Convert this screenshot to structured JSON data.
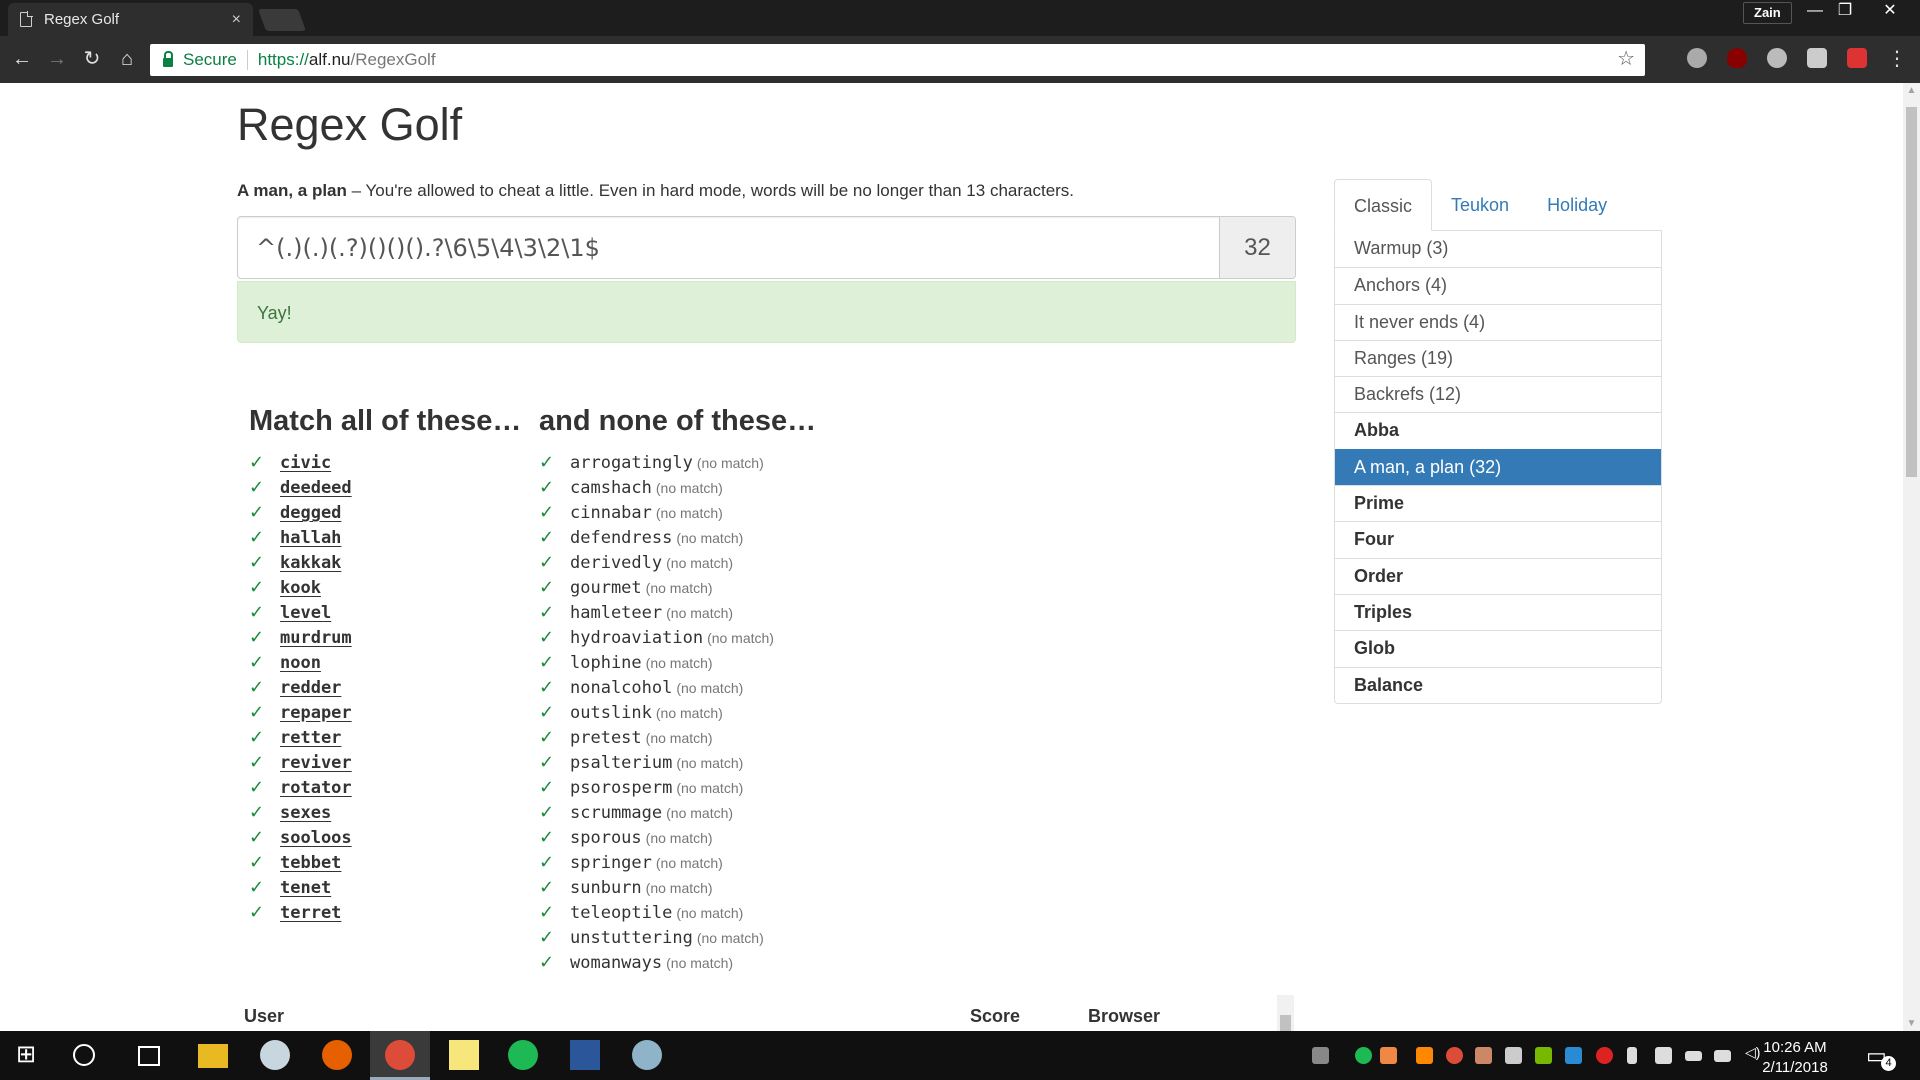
{
  "browser": {
    "tab_title": "Regex Golf",
    "tab_close": "×",
    "profile_name": "Zain",
    "url_secure_label": "Secure",
    "url_scheme": "https://",
    "url_host": "alf.nu",
    "url_path": "/RegexGolf"
  },
  "page": {
    "title": "Regex Golf",
    "level_name": "A man, a plan",
    "level_description": " – You're allowed to cheat a little. Even in hard mode, words will be no longer than 13 characters.",
    "regex_value": "^(.)(.)(.?)()()().?\\6\\5\\4\\3\\2\\1$",
    "score": "32",
    "result_message": "Yay!",
    "match_heading": "Match all of these…",
    "nomatch_heading": "and none of these…",
    "check_mark": "✓",
    "nomatch_note": "(no match)",
    "match_words": [
      "civic",
      "deedeed",
      "degged",
      "hallah",
      "kakkak",
      "kook",
      "level",
      "murdrum",
      "noon",
      "redder",
      "repaper",
      "retter",
      "reviver",
      "rotator",
      "sexes",
      "sooloos",
      "tebbet",
      "tenet",
      "terret"
    ],
    "nomatch_words": [
      "arrogatingly",
      "camshach",
      "cinnabar",
      "defendress",
      "derivedly",
      "gourmet",
      "hamleteer",
      "hydroaviation",
      "lophine",
      "nonalcohol",
      "outslink",
      "pretest",
      "psalterium",
      "psorosperm",
      "scrummage",
      "sporous",
      "springer",
      "sunburn",
      "teleoptile",
      "unstuttering",
      "womanways"
    ],
    "leaderboard_headers": {
      "user": "User",
      "score": "Score",
      "browser": "Browser"
    }
  },
  "sidebar": {
    "tabs": [
      "Classic",
      "Teukon",
      "Holiday"
    ],
    "active_tab": 0,
    "levels": [
      {
        "label": "Warmup (3)",
        "bold": false
      },
      {
        "label": "Anchors (4)",
        "bold": false
      },
      {
        "label": "It never ends (4)",
        "bold": false
      },
      {
        "label": "Ranges (19)",
        "bold": false
      },
      {
        "label": "Backrefs (12)",
        "bold": false
      },
      {
        "label": "Abba",
        "bold": true
      },
      {
        "label": "A man, a plan (32)",
        "bold": false,
        "active": true
      },
      {
        "label": "Prime",
        "bold": true
      },
      {
        "label": "Four",
        "bold": true
      },
      {
        "label": "Order",
        "bold": true
      },
      {
        "label": "Triples",
        "bold": true
      },
      {
        "label": "Glob",
        "bold": true
      },
      {
        "label": "Balance",
        "bold": true
      }
    ]
  },
  "taskbar": {
    "time": "10:26 AM",
    "date": "2/11/2018",
    "notification_count": "4"
  },
  "colors": {
    "accent": "#337ab7",
    "success_bg": "#dff0d8",
    "success_text": "#3c763d",
    "check": "#1a8a3a"
  }
}
